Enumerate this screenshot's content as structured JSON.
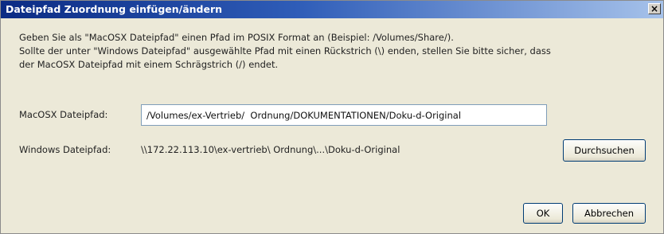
{
  "window": {
    "title": "Dateipfad Zuordnung einfügen/ändern",
    "close_glyph": "×"
  },
  "instructions": {
    "line1": "Geben Sie als \"MacOSX Dateipfad\" einen Pfad im POSIX Format an (Beispiel: /Volumes/Share/).",
    "line2": "Sollte der unter \"Windows Dateipfad\" ausgewählte Pfad mit einen Rückstrich (\\) enden, stellen Sie bitte sicher, dass",
    "line3": "der MacOSX Dateipfad mit einem Schrägstrich (/) endet."
  },
  "macosx": {
    "label": "MacOSX Dateipfad:",
    "value": "/Volumes/ex-Vertrieb/  Ordnung/DOKUMENTATIONEN/Doku-d-Original"
  },
  "windows": {
    "label": "Windows Dateipfad:",
    "value": "\\\\172.22.113.10\\ex-vertrieb\\  Ordnung\\...\\Doku-d-Original"
  },
  "buttons": {
    "browse": "Durchsuchen",
    "ok": "OK",
    "cancel": "Abbrechen"
  },
  "colors": {
    "titlebar_start": "#0b2b84",
    "titlebar_end": "#a6c2ea",
    "dialog_bg": "#ece9d8",
    "button_border": "#003c74"
  }
}
